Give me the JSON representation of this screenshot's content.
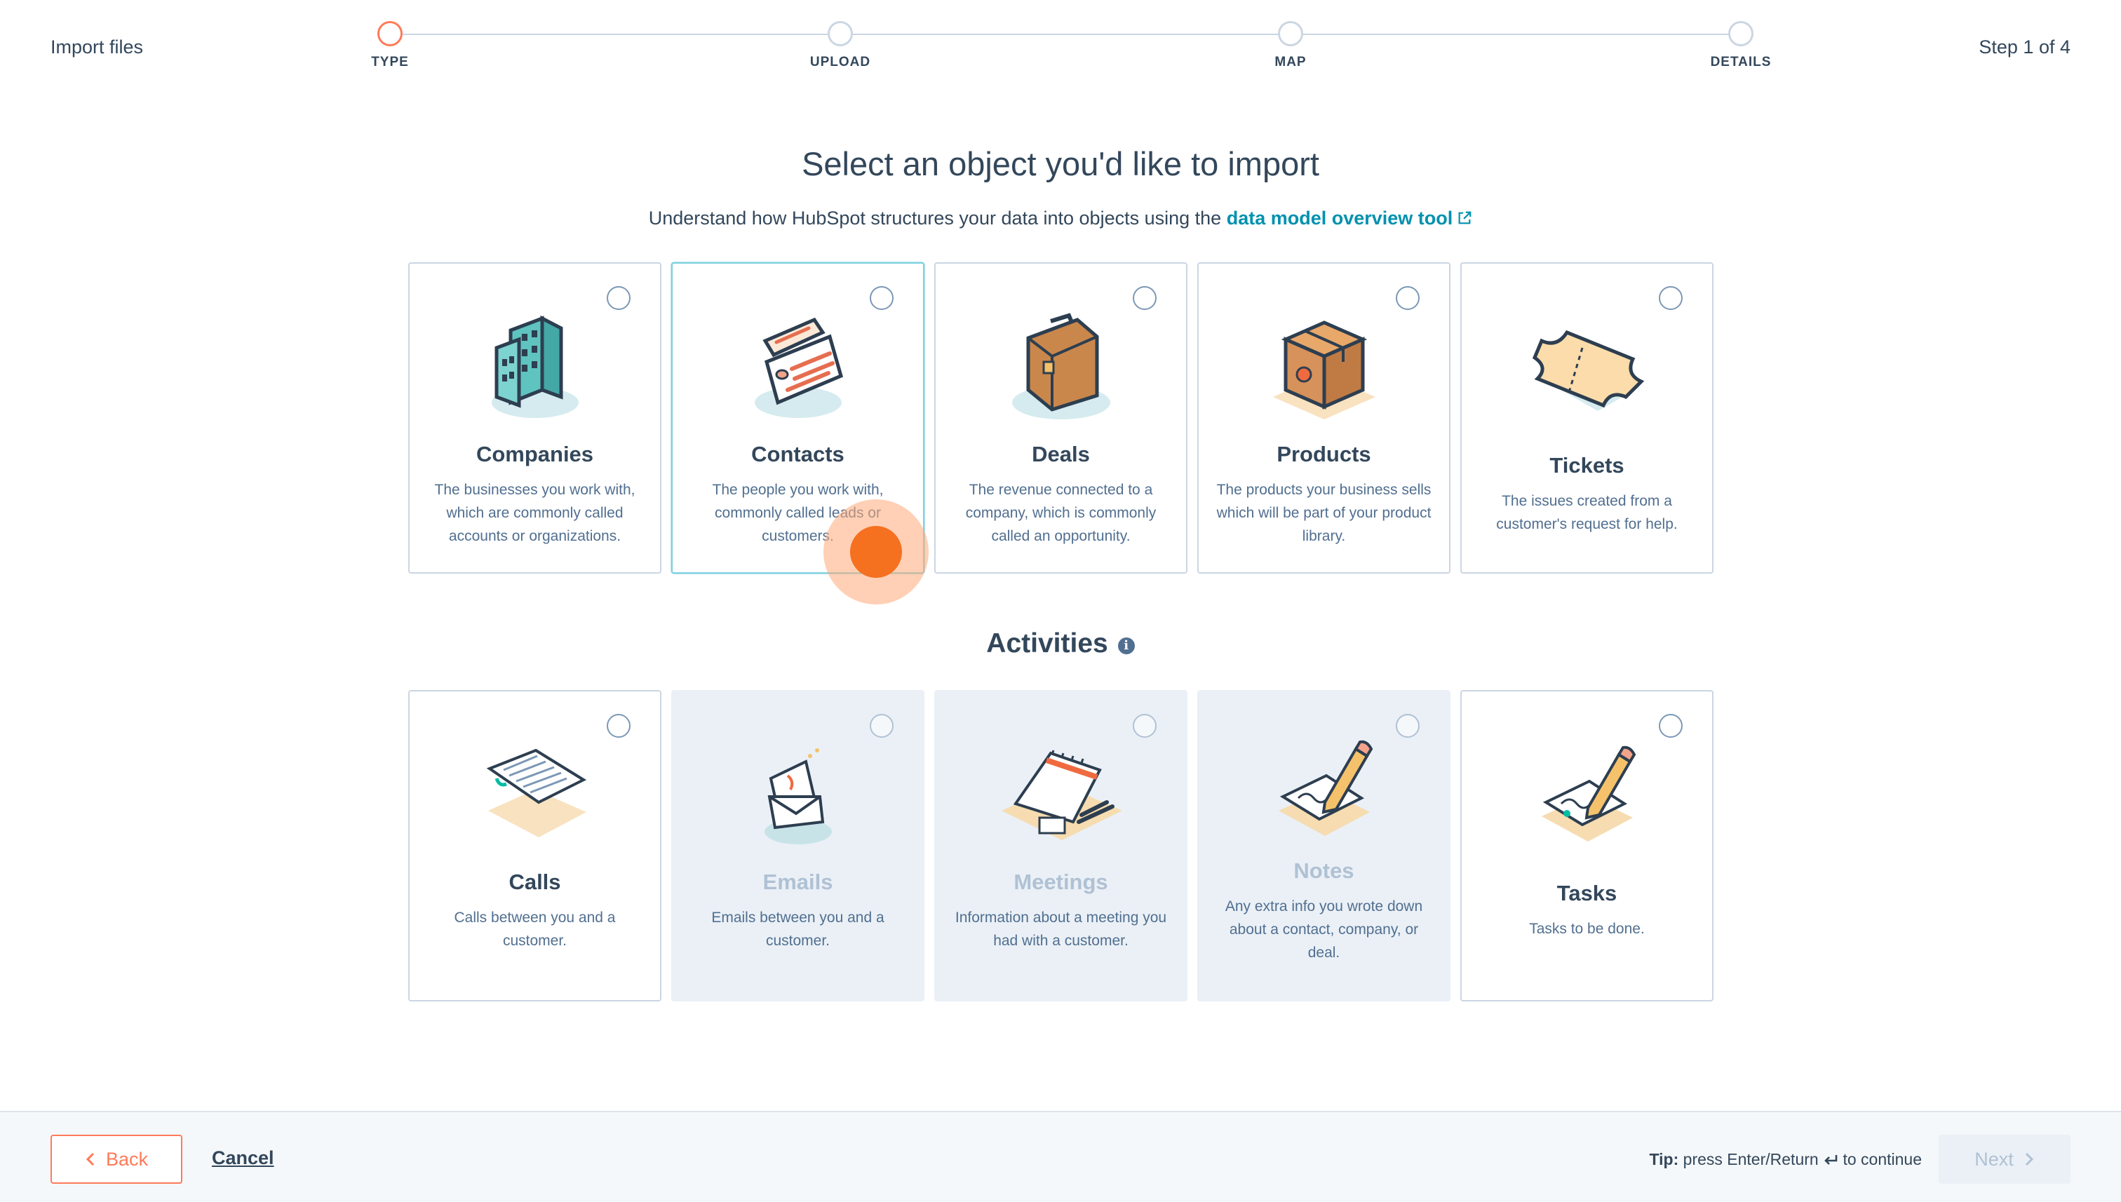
{
  "header": {
    "title": "Import files",
    "step_indicator": "Step 1 of 4",
    "steps": [
      {
        "label": "TYPE",
        "active": true
      },
      {
        "label": "UPLOAD",
        "active": false
      },
      {
        "label": "MAP",
        "active": false
      },
      {
        "label": "DETAILS",
        "active": false
      }
    ]
  },
  "main": {
    "title": "Select an object you'd like to import",
    "subtitle_prefix": "Understand how HubSpot structures your data into objects using the",
    "subtitle_link": "data model overview tool",
    "objects": [
      {
        "name": "Companies",
        "description": "The businesses you work with, which are commonly called accounts or organizations.",
        "icon": "companies-building-icon",
        "disabled": false
      },
      {
        "name": "Contacts",
        "description": "The people you work with, commonly called leads or customers.",
        "icon": "contacts-cards-icon",
        "disabled": false
      },
      {
        "name": "Deals",
        "description": "The revenue connected to a company, which is commonly called an opportunity.",
        "icon": "deals-briefcase-icon",
        "disabled": false
      },
      {
        "name": "Products",
        "description": "The products your business sells which will be part of your product library.",
        "icon": "products-box-icon",
        "disabled": false
      },
      {
        "name": "Tickets",
        "description": "The issues created from a customer's request for help.",
        "icon": "tickets-ticket-icon",
        "disabled": false
      }
    ],
    "activities_heading": "Activities",
    "activities": [
      {
        "name": "Calls",
        "description": "Calls between you and a customer.",
        "icon": "calls-paper-icon",
        "disabled": false
      },
      {
        "name": "Emails",
        "description": "Emails between you and a customer.",
        "icon": "emails-envelope-icon",
        "disabled": true
      },
      {
        "name": "Meetings",
        "description": "Information about a meeting you had with a customer.",
        "icon": "meetings-calendar-icon",
        "disabled": true
      },
      {
        "name": "Notes",
        "description": "Any extra info you wrote down about a contact, company, or deal.",
        "icon": "notes-pencil-icon",
        "disabled": true
      },
      {
        "name": "Tasks",
        "description": "Tasks to be done.",
        "icon": "tasks-pencil-icon",
        "disabled": false
      }
    ]
  },
  "footer": {
    "back_label": "Back",
    "cancel_label": "Cancel",
    "tip_bold": "Tip:",
    "tip_text": "press Enter/Return",
    "tip_suffix": "to continue",
    "next_label": "Next"
  },
  "colors": {
    "accent": "#ff7a59",
    "link": "#0091ae",
    "text": "#33475b",
    "border": "#cbd6e2",
    "disabled_bg": "#eaf0f6"
  }
}
